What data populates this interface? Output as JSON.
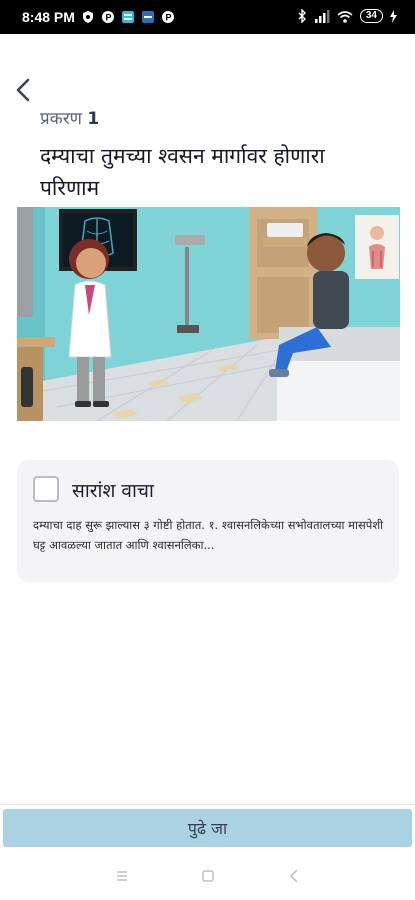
{
  "status_bar": {
    "time": "8:48 PM",
    "battery": "34",
    "icons": [
      "shield-icon",
      "p-icon",
      "app-icon",
      "app-icon",
      "p-icon",
      "bluetooth-icon",
      "signal-icon",
      "wifi-icon",
      "battery-icon",
      "charging-icon"
    ]
  },
  "header": {
    "back_icon": "chevron-left-icon",
    "chapter_label": "प्रकरण",
    "chapter_number": "1",
    "title": "दम्याचा तुमच्या श्वसन मार्गावर होणारा परिणाम"
  },
  "summary_card": {
    "checkbox_checked": false,
    "title": "सारांश वाचा",
    "text": "दम्याचा दाह सुरू झाल्यास ३ गोष्टी होतात. १. श्वासनलिकेच्या सभोवतालच्या मासपेशी घट्ट आवळल्या जातात आणि श्वासनलिका..."
  },
  "footer": {
    "next_button_label": "पुढे जा"
  },
  "colors": {
    "button_bg": "#a9d2e3",
    "card_bg": "#f4f4f6",
    "back_icon": "#3a3f6b"
  }
}
